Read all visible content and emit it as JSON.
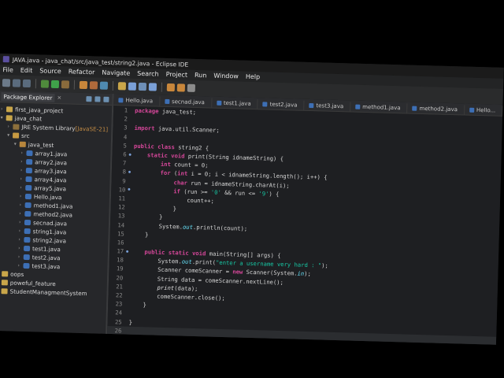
{
  "window": {
    "title": "JAVA.java - java_chat/src/java_test/string2.java - Eclipse IDE"
  },
  "menu": [
    "File",
    "Edit",
    "Source",
    "Refactor",
    "Navigate",
    "Search",
    "Project",
    "Run",
    "Window",
    "Help"
  ],
  "explorer": {
    "title": "Package Explorer",
    "nodes": [
      {
        "label": "first_java_project",
        "indent": 0,
        "icon": "project",
        "arrow": ">"
      },
      {
        "label": "java_chat",
        "indent": 0,
        "icon": "project",
        "arrow": "v"
      },
      {
        "label": "JRE System Library",
        "suffix": " [JavaSE-21]",
        "indent": 1,
        "icon": "jre",
        "arrow": ">"
      },
      {
        "label": "src",
        "indent": 1,
        "icon": "folder",
        "arrow": "v"
      },
      {
        "label": "java_test",
        "indent": 2,
        "icon": "pkg",
        "arrow": "v"
      },
      {
        "label": "array1.java",
        "indent": 3,
        "icon": "java",
        "arrow": ">"
      },
      {
        "label": "array2.java",
        "indent": 3,
        "icon": "java",
        "arrow": ">"
      },
      {
        "label": "array3.java",
        "indent": 3,
        "icon": "java",
        "arrow": ">"
      },
      {
        "label": "array4.java",
        "indent": 3,
        "icon": "java",
        "arrow": ">"
      },
      {
        "label": "array5.java",
        "indent": 3,
        "icon": "java",
        "arrow": ">"
      },
      {
        "label": "Hello.java",
        "indent": 3,
        "icon": "java",
        "arrow": ">"
      },
      {
        "label": "method1.java",
        "indent": 3,
        "icon": "java",
        "arrow": ">"
      },
      {
        "label": "method2.java",
        "indent": 3,
        "icon": "java",
        "arrow": ">"
      },
      {
        "label": "secnad.java",
        "indent": 3,
        "icon": "java",
        "arrow": ">"
      },
      {
        "label": "string1.java",
        "indent": 3,
        "icon": "java",
        "arrow": ">"
      },
      {
        "label": "string2.java",
        "indent": 3,
        "icon": "java",
        "arrow": ">"
      },
      {
        "label": "test1.java",
        "indent": 3,
        "icon": "java",
        "arrow": ">"
      },
      {
        "label": "test2.java",
        "indent": 3,
        "icon": "java",
        "arrow": ">"
      },
      {
        "label": "test3.java",
        "indent": 3,
        "icon": "java",
        "arrow": ">"
      },
      {
        "label": "oops",
        "indent": 0,
        "icon": "project",
        "arrow": ">"
      },
      {
        "label": "poweful_feature",
        "indent": 0,
        "icon": "project",
        "arrow": ">"
      },
      {
        "label": "StudentManagmentSystem",
        "indent": 0,
        "icon": "project",
        "arrow": ">"
      }
    ]
  },
  "tabs": [
    "Hello.java",
    "secnad.java",
    "test1.java",
    "test2.java",
    "test3.java",
    "method1.java",
    "method2.java",
    "Hello..."
  ],
  "code": [
    [
      [
        "kw",
        "package "
      ],
      [
        "txt",
        "java_test;"
      ]
    ],
    [],
    [
      [
        "kw",
        "import "
      ],
      [
        "txt",
        "java.util.Scanner;"
      ]
    ],
    [],
    [
      [
        "kw",
        "public class "
      ],
      [
        "txt",
        "string2 {"
      ]
    ],
    [
      [
        "txt",
        "    "
      ],
      [
        "kw",
        "static void "
      ],
      [
        "txt",
        "print(String idnameString) {"
      ]
    ],
    [
      [
        "txt",
        "        "
      ],
      [
        "kw",
        "int "
      ],
      [
        "txt",
        "count = 0;"
      ]
    ],
    [
      [
        "txt",
        "        "
      ],
      [
        "kw",
        "for "
      ],
      [
        "txt",
        "("
      ],
      [
        "kw",
        "int "
      ],
      [
        "txt",
        "i = 0; i < idnameString.length(); i++) {"
      ]
    ],
    [
      [
        "txt",
        "            "
      ],
      [
        "kw",
        "char "
      ],
      [
        "txt",
        "run = idnameString.charAt(i);"
      ]
    ],
    [
      [
        "txt",
        "            "
      ],
      [
        "kw",
        "if "
      ],
      [
        "txt",
        "(run >= "
      ],
      [
        "str",
        "'0'"
      ],
      [
        "txt",
        " && run <= "
      ],
      [
        "str",
        "'9'"
      ],
      [
        "txt",
        ") {"
      ]
    ],
    [
      [
        "txt",
        "                count++;"
      ]
    ],
    [
      [
        "txt",
        "            }"
      ]
    ],
    [
      [
        "txt",
        "        }"
      ]
    ],
    [
      [
        "txt",
        "        System."
      ],
      [
        "fld",
        "out"
      ],
      [
        "txt",
        ".println(count);"
      ]
    ],
    [
      [
        "txt",
        "    }"
      ]
    ],
    [],
    [
      [
        "txt",
        "    "
      ],
      [
        "kw",
        "public static void "
      ],
      [
        "txt",
        "main(String[] args) {"
      ]
    ],
    [
      [
        "txt",
        "        System."
      ],
      [
        "fld",
        "out"
      ],
      [
        "txt",
        ".print("
      ],
      [
        "str",
        "\"enter a username very hard : \""
      ],
      [
        "txt",
        ");"
      ]
    ],
    [
      [
        "txt",
        "        Scanner comeScanner = "
      ],
      [
        "kw",
        "new "
      ],
      [
        "txt",
        "Scanner(System."
      ],
      [
        "fld",
        "in"
      ],
      [
        "txt",
        ");"
      ]
    ],
    [
      [
        "txt",
        "        String data = comeScanner.nextLine();"
      ]
    ],
    [
      [
        "txt",
        "        "
      ],
      [
        "mth",
        "print"
      ],
      [
        "txt",
        "(data);"
      ]
    ],
    [
      [
        "txt",
        "        comeScanner.close();"
      ]
    ],
    [
      [
        "txt",
        "    }"
      ]
    ],
    [],
    [
      [
        "txt",
        "}"
      ]
    ],
    [
      [
        "txt",
        ""
      ]
    ]
  ],
  "markers": {
    "6": "●",
    "8": "●",
    "10": "●",
    "17": "●"
  },
  "current_line": 26
}
